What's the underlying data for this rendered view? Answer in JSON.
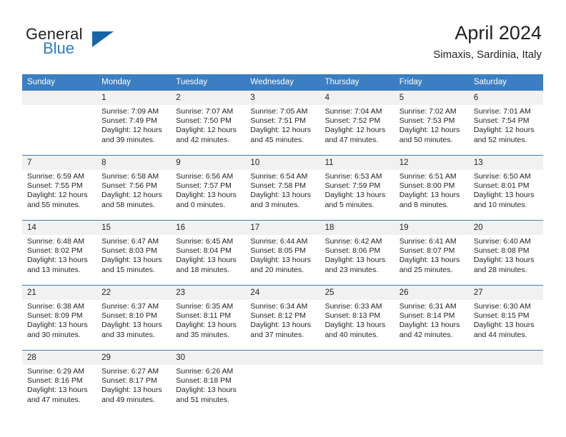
{
  "brand": {
    "name_top": "General",
    "name_bottom": "Blue",
    "accent_color": "#2a7cc7",
    "triangle_color": "#1565a8"
  },
  "header": {
    "title": "April 2024",
    "subtitle": "Simaxis, Sardinia, Italy"
  },
  "calendar": {
    "header_bg": "#3b7ec1",
    "header_text_color": "#ffffff",
    "daynum_bg": "#f1f1f1",
    "weekdays": [
      "Sunday",
      "Monday",
      "Tuesday",
      "Wednesday",
      "Thursday",
      "Friday",
      "Saturday"
    ],
    "weeks": [
      [
        {
          "day": "",
          "sunrise": "",
          "sunset": "",
          "daylight_1": "",
          "daylight_2": ""
        },
        {
          "day": "1",
          "sunrise": "Sunrise: 7:09 AM",
          "sunset": "Sunset: 7:49 PM",
          "daylight_1": "Daylight: 12 hours",
          "daylight_2": "and 39 minutes."
        },
        {
          "day": "2",
          "sunrise": "Sunrise: 7:07 AM",
          "sunset": "Sunset: 7:50 PM",
          "daylight_1": "Daylight: 12 hours",
          "daylight_2": "and 42 minutes."
        },
        {
          "day": "3",
          "sunrise": "Sunrise: 7:05 AM",
          "sunset": "Sunset: 7:51 PM",
          "daylight_1": "Daylight: 12 hours",
          "daylight_2": "and 45 minutes."
        },
        {
          "day": "4",
          "sunrise": "Sunrise: 7:04 AM",
          "sunset": "Sunset: 7:52 PM",
          "daylight_1": "Daylight: 12 hours",
          "daylight_2": "and 47 minutes."
        },
        {
          "day": "5",
          "sunrise": "Sunrise: 7:02 AM",
          "sunset": "Sunset: 7:53 PM",
          "daylight_1": "Daylight: 12 hours",
          "daylight_2": "and 50 minutes."
        },
        {
          "day": "6",
          "sunrise": "Sunrise: 7:01 AM",
          "sunset": "Sunset: 7:54 PM",
          "daylight_1": "Daylight: 12 hours",
          "daylight_2": "and 52 minutes."
        }
      ],
      [
        {
          "day": "7",
          "sunrise": "Sunrise: 6:59 AM",
          "sunset": "Sunset: 7:55 PM",
          "daylight_1": "Daylight: 12 hours",
          "daylight_2": "and 55 minutes."
        },
        {
          "day": "8",
          "sunrise": "Sunrise: 6:58 AM",
          "sunset": "Sunset: 7:56 PM",
          "daylight_1": "Daylight: 12 hours",
          "daylight_2": "and 58 minutes."
        },
        {
          "day": "9",
          "sunrise": "Sunrise: 6:56 AM",
          "sunset": "Sunset: 7:57 PM",
          "daylight_1": "Daylight: 13 hours",
          "daylight_2": "and 0 minutes."
        },
        {
          "day": "10",
          "sunrise": "Sunrise: 6:54 AM",
          "sunset": "Sunset: 7:58 PM",
          "daylight_1": "Daylight: 13 hours",
          "daylight_2": "and 3 minutes."
        },
        {
          "day": "11",
          "sunrise": "Sunrise: 6:53 AM",
          "sunset": "Sunset: 7:59 PM",
          "daylight_1": "Daylight: 13 hours",
          "daylight_2": "and 5 minutes."
        },
        {
          "day": "12",
          "sunrise": "Sunrise: 6:51 AM",
          "sunset": "Sunset: 8:00 PM",
          "daylight_1": "Daylight: 13 hours",
          "daylight_2": "and 8 minutes."
        },
        {
          "day": "13",
          "sunrise": "Sunrise: 6:50 AM",
          "sunset": "Sunset: 8:01 PM",
          "daylight_1": "Daylight: 13 hours",
          "daylight_2": "and 10 minutes."
        }
      ],
      [
        {
          "day": "14",
          "sunrise": "Sunrise: 6:48 AM",
          "sunset": "Sunset: 8:02 PM",
          "daylight_1": "Daylight: 13 hours",
          "daylight_2": "and 13 minutes."
        },
        {
          "day": "15",
          "sunrise": "Sunrise: 6:47 AM",
          "sunset": "Sunset: 8:03 PM",
          "daylight_1": "Daylight: 13 hours",
          "daylight_2": "and 15 minutes."
        },
        {
          "day": "16",
          "sunrise": "Sunrise: 6:45 AM",
          "sunset": "Sunset: 8:04 PM",
          "daylight_1": "Daylight: 13 hours",
          "daylight_2": "and 18 minutes."
        },
        {
          "day": "17",
          "sunrise": "Sunrise: 6:44 AM",
          "sunset": "Sunset: 8:05 PM",
          "daylight_1": "Daylight: 13 hours",
          "daylight_2": "and 20 minutes."
        },
        {
          "day": "18",
          "sunrise": "Sunrise: 6:42 AM",
          "sunset": "Sunset: 8:06 PM",
          "daylight_1": "Daylight: 13 hours",
          "daylight_2": "and 23 minutes."
        },
        {
          "day": "19",
          "sunrise": "Sunrise: 6:41 AM",
          "sunset": "Sunset: 8:07 PM",
          "daylight_1": "Daylight: 13 hours",
          "daylight_2": "and 25 minutes."
        },
        {
          "day": "20",
          "sunrise": "Sunrise: 6:40 AM",
          "sunset": "Sunset: 8:08 PM",
          "daylight_1": "Daylight: 13 hours",
          "daylight_2": "and 28 minutes."
        }
      ],
      [
        {
          "day": "21",
          "sunrise": "Sunrise: 6:38 AM",
          "sunset": "Sunset: 8:09 PM",
          "daylight_1": "Daylight: 13 hours",
          "daylight_2": "and 30 minutes."
        },
        {
          "day": "22",
          "sunrise": "Sunrise: 6:37 AM",
          "sunset": "Sunset: 8:10 PM",
          "daylight_1": "Daylight: 13 hours",
          "daylight_2": "and 33 minutes."
        },
        {
          "day": "23",
          "sunrise": "Sunrise: 6:35 AM",
          "sunset": "Sunset: 8:11 PM",
          "daylight_1": "Daylight: 13 hours",
          "daylight_2": "and 35 minutes."
        },
        {
          "day": "24",
          "sunrise": "Sunrise: 6:34 AM",
          "sunset": "Sunset: 8:12 PM",
          "daylight_1": "Daylight: 13 hours",
          "daylight_2": "and 37 minutes."
        },
        {
          "day": "25",
          "sunrise": "Sunrise: 6:33 AM",
          "sunset": "Sunset: 8:13 PM",
          "daylight_1": "Daylight: 13 hours",
          "daylight_2": "and 40 minutes."
        },
        {
          "day": "26",
          "sunrise": "Sunrise: 6:31 AM",
          "sunset": "Sunset: 8:14 PM",
          "daylight_1": "Daylight: 13 hours",
          "daylight_2": "and 42 minutes."
        },
        {
          "day": "27",
          "sunrise": "Sunrise: 6:30 AM",
          "sunset": "Sunset: 8:15 PM",
          "daylight_1": "Daylight: 13 hours",
          "daylight_2": "and 44 minutes."
        }
      ],
      [
        {
          "day": "28",
          "sunrise": "Sunrise: 6:29 AM",
          "sunset": "Sunset: 8:16 PM",
          "daylight_1": "Daylight: 13 hours",
          "daylight_2": "and 47 minutes."
        },
        {
          "day": "29",
          "sunrise": "Sunrise: 6:27 AM",
          "sunset": "Sunset: 8:17 PM",
          "daylight_1": "Daylight: 13 hours",
          "daylight_2": "and 49 minutes."
        },
        {
          "day": "30",
          "sunrise": "Sunrise: 6:26 AM",
          "sunset": "Sunset: 8:18 PM",
          "daylight_1": "Daylight: 13 hours",
          "daylight_2": "and 51 minutes."
        },
        {
          "day": "",
          "sunrise": "",
          "sunset": "",
          "daylight_1": "",
          "daylight_2": ""
        },
        {
          "day": "",
          "sunrise": "",
          "sunset": "",
          "daylight_1": "",
          "daylight_2": ""
        },
        {
          "day": "",
          "sunrise": "",
          "sunset": "",
          "daylight_1": "",
          "daylight_2": ""
        },
        {
          "day": "",
          "sunrise": "",
          "sunset": "",
          "daylight_1": "",
          "daylight_2": ""
        }
      ]
    ]
  }
}
